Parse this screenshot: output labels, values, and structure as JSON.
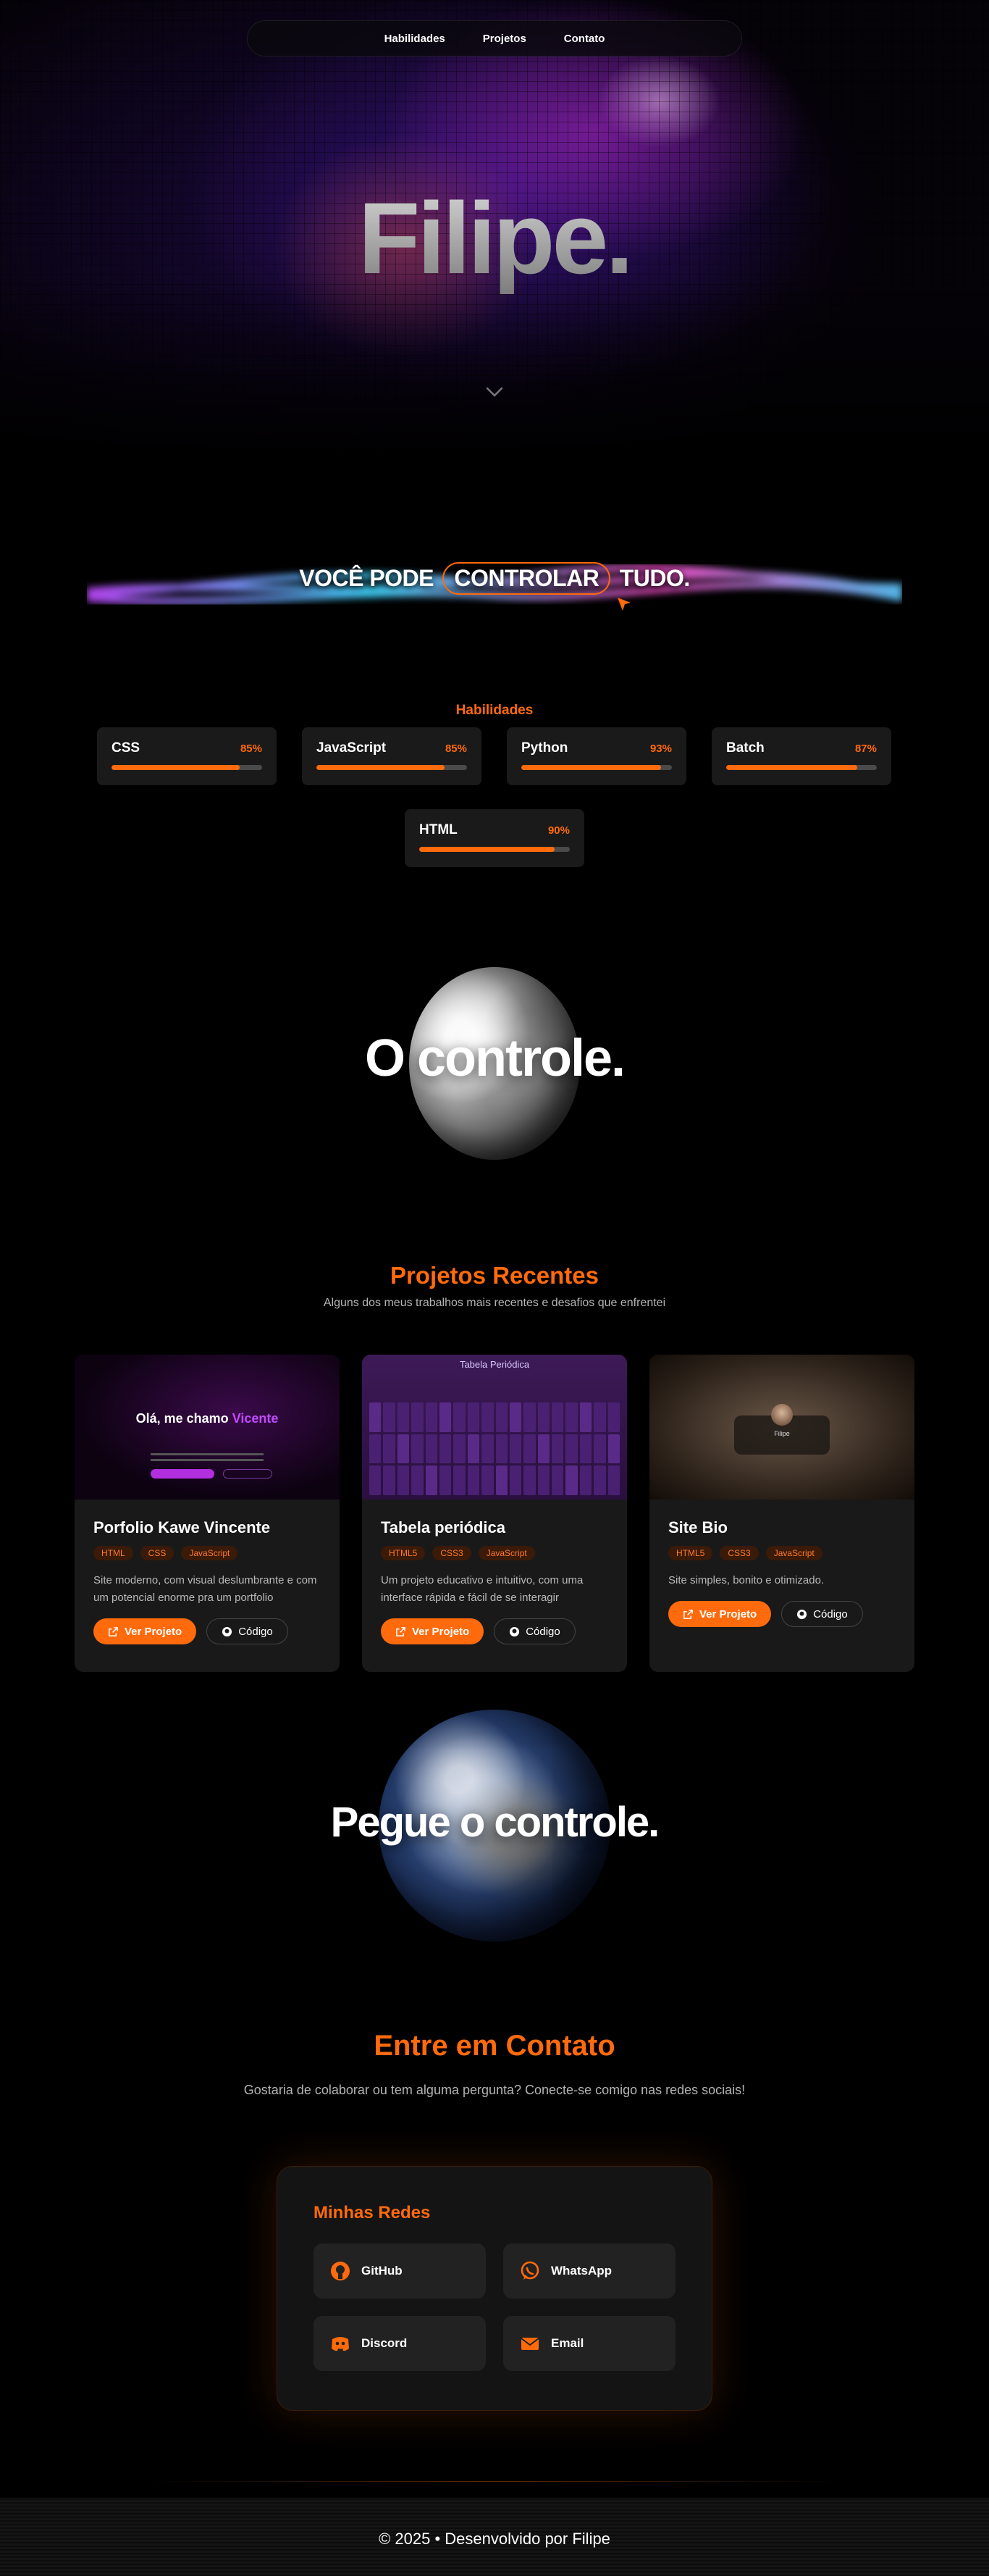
{
  "nav": {
    "items": [
      "Habilidades",
      "Projetos",
      "Contato"
    ]
  },
  "hero": {
    "title": "Filipe."
  },
  "banner": {
    "prefix": "VOCÊ PODE",
    "highlight": "CONTROLAR",
    "suffix": "TUDO."
  },
  "skills": {
    "title": "Habilidades",
    "items": [
      {
        "name": "CSS",
        "percent_label": "85%",
        "percent": 85
      },
      {
        "name": "JavaScript",
        "percent_label": "85%",
        "percent": 85
      },
      {
        "name": "Python",
        "percent_label": "93%",
        "percent": 93
      },
      {
        "name": "Batch",
        "percent_label": "87%",
        "percent": 87
      },
      {
        "name": "HTML",
        "percent_label": "90%",
        "percent": 90
      }
    ]
  },
  "statements": {
    "first": "O controle.",
    "second": "Pegue o controle."
  },
  "projects": {
    "title": "Projetos Recentes",
    "subtitle": "Alguns dos meus trabalhos mais recentes e desafios que enfrentei",
    "view_label": "Ver Projeto",
    "code_label": "Código",
    "items": [
      {
        "name": "Porfolio Kawe Vincente",
        "tags": [
          "HTML",
          "CSS",
          "JavaScript"
        ],
        "description": "Site moderno, com visual deslumbrante e com um potencial enorme pra um portfolio",
        "preview_heading": "Olá, me chamo",
        "preview_name": "Vicente"
      },
      {
        "name": "Tabela periódica",
        "tags": [
          "HTML5",
          "CSS3",
          "JavaScript"
        ],
        "description": "Um projeto educativo e intuitivo, com uma interface rápida e fácil de se interagir",
        "preview_heading": "Tabela Periódica"
      },
      {
        "name": "Site Bio",
        "tags": [
          "HTML5",
          "CSS3",
          "JavaScript"
        ],
        "description": "Site simples, bonito e otimizado.",
        "preview_heading": "Filipe"
      }
    ]
  },
  "contact": {
    "title": "Entre em Contato",
    "subtitle": "Gostaria de colaborar ou tem alguma pergunta? Conecte-se comigo nas redes sociais!",
    "card_title": "Minhas Redes",
    "links": [
      {
        "label": "GitHub",
        "icon": "github-icon"
      },
      {
        "label": "WhatsApp",
        "icon": "whatsapp-icon"
      },
      {
        "label": "Discord",
        "icon": "discord-icon"
      },
      {
        "label": "Email",
        "icon": "email-icon"
      }
    ]
  },
  "footer": {
    "text": "© 2025 • Desenvolvido por Filipe"
  },
  "colors": {
    "accent": "#ff6a0c",
    "card": "#1a1a1a",
    "background": "#000000"
  }
}
